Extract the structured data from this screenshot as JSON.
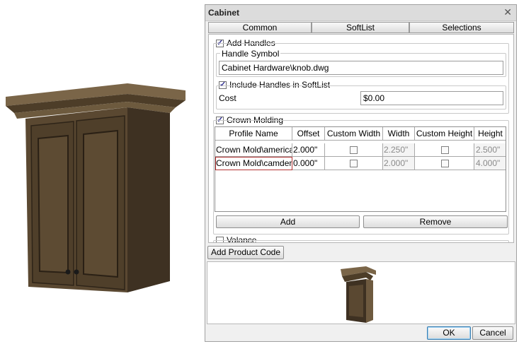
{
  "window": {
    "title": "Cabinet"
  },
  "tabs": [
    "Common",
    "SoftList",
    "Selections"
  ],
  "handles": {
    "add_handles_label": "Add Handles",
    "add_handles_checked": true,
    "handle_symbol_label": "Handle Symbol",
    "handle_symbol_value": "Cabinet Hardware\\knob.dwg",
    "include_softlist_label": "Include Handles in SoftList",
    "include_softlist_checked": true,
    "cost_label": "Cost",
    "cost_value": "$0.00"
  },
  "crown_molding": {
    "label": "Crown Molding",
    "checked": true,
    "columns": [
      "Profile Name",
      "Offset",
      "Custom Width",
      "Width",
      "Custom Height",
      "Height"
    ],
    "rows": [
      {
        "profile": "Crown Mold\\american",
        "offset": "2.000\"",
        "custom_width": false,
        "width": "2.250\"",
        "custom_height": false,
        "height": "2.500\""
      },
      {
        "profile": "Crown Mold\\camden",
        "offset": "0.000\"",
        "custom_width": false,
        "width": "2.000\"",
        "custom_height": false,
        "height": "4.000\""
      }
    ],
    "add_label": "Add",
    "remove_label": "Remove"
  },
  "valance": {
    "label": "Valance",
    "checked": false
  },
  "add_product_code_label": "Add Product Code",
  "footer": {
    "ok_label": "OK",
    "cancel_label": "Cancel"
  },
  "icons": {
    "close": "close-icon",
    "check": "check-icon"
  },
  "colors": {
    "cabinet_wood": "#54432d",
    "crown_wood": "#6e5a3f",
    "selection_border": "#b33333",
    "ok_border": "#3c7fb1"
  }
}
